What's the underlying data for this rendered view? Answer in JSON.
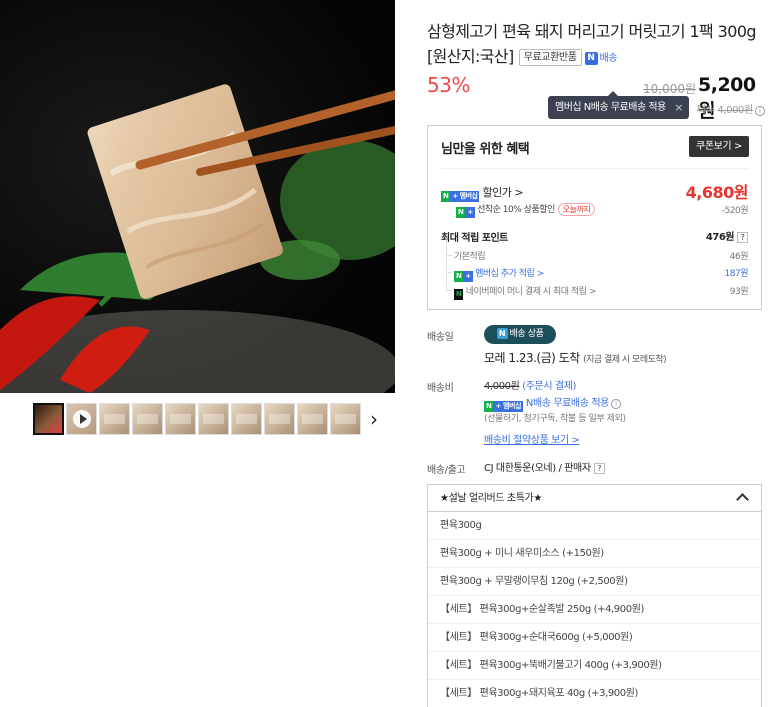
{
  "gallery": {
    "hero_alt": "product image",
    "thumb_count": 10,
    "next_icon": "chevron-right-icon"
  },
  "product": {
    "title": "삼형제고기 편육 돼지 머리고기 머릿고기 1팩 300g [원산지:국산]",
    "free_exchange_badge": "무료교환반품",
    "n_badge": "배송",
    "discount_rate": "53%",
    "original_price": "10,000원",
    "final_price": "5,200원"
  },
  "tooltip": {
    "text": "멤버십 N배송 무료배송 적용",
    "close": "×"
  },
  "ship_mini": {
    "label": "택배",
    "price": "4,000원",
    "info": "i"
  },
  "benefit": {
    "title": "님만을 위한 혜택",
    "coupon_button": "쿠폰보기 >",
    "discount_label": "할인가 >",
    "discount_price": "4,680원",
    "first_come": "선착순 10% 상품할인",
    "today_only": "오늘까지",
    "first_come_amount": "-520원",
    "points_label": "최대 적립 포인트",
    "points_total": "476원",
    "points_help": "?",
    "basic_label": "기본적립",
    "basic_amount": "46원",
    "membership_label": "멤버십 추가 적립 >",
    "membership_amount": "187원",
    "npay_label": "네이버페이 머니 결제 시 최대 적립 >",
    "npay_amount": "93원"
  },
  "delivery": {
    "date_label": "배송일",
    "n_pill": "배송 상품",
    "arrival": "모레 1.23.(금) 도착",
    "arrival_note": "(지금 결제 시 모레도착)",
    "fee_label": "배송비",
    "fee_original": "4,000원",
    "fee_note": "(주문시 결제)",
    "member_free": "N배송 무료배송 적용",
    "exclusions": "(선물하기, 정기구독, 착불 등 일부 제외)",
    "save_link": "배송비 절약상품 보기 >",
    "carrier_label": "배송/출고",
    "carrier": "CJ 대한통운(오네) / 판매자",
    "carrier_help": "?"
  },
  "options": {
    "header": "★설날 얼리버드 초특가★",
    "items": [
      "편육300g",
      "편육300g + 미니 새우미소스 (+150원)",
      "편육300g + 무말랭이무침 120g (+2,500원)",
      "【세트】 편육300g+순살족발 250g (+4,900원)",
      "【세트】 편육300g+순대국600g (+5,000원)",
      "【세트】 편육300g+뚝배기불고기 400g (+3,900원)",
      "【세트】 편육300g+돼지육포 40g (+3,900원)"
    ]
  },
  "colors": {
    "discount_red": "#f04848",
    "price_red": "#e8342c",
    "naver_green": "#14b14a",
    "link_blue": "#3a6fe0",
    "pill_teal": "#1d4f5a"
  }
}
